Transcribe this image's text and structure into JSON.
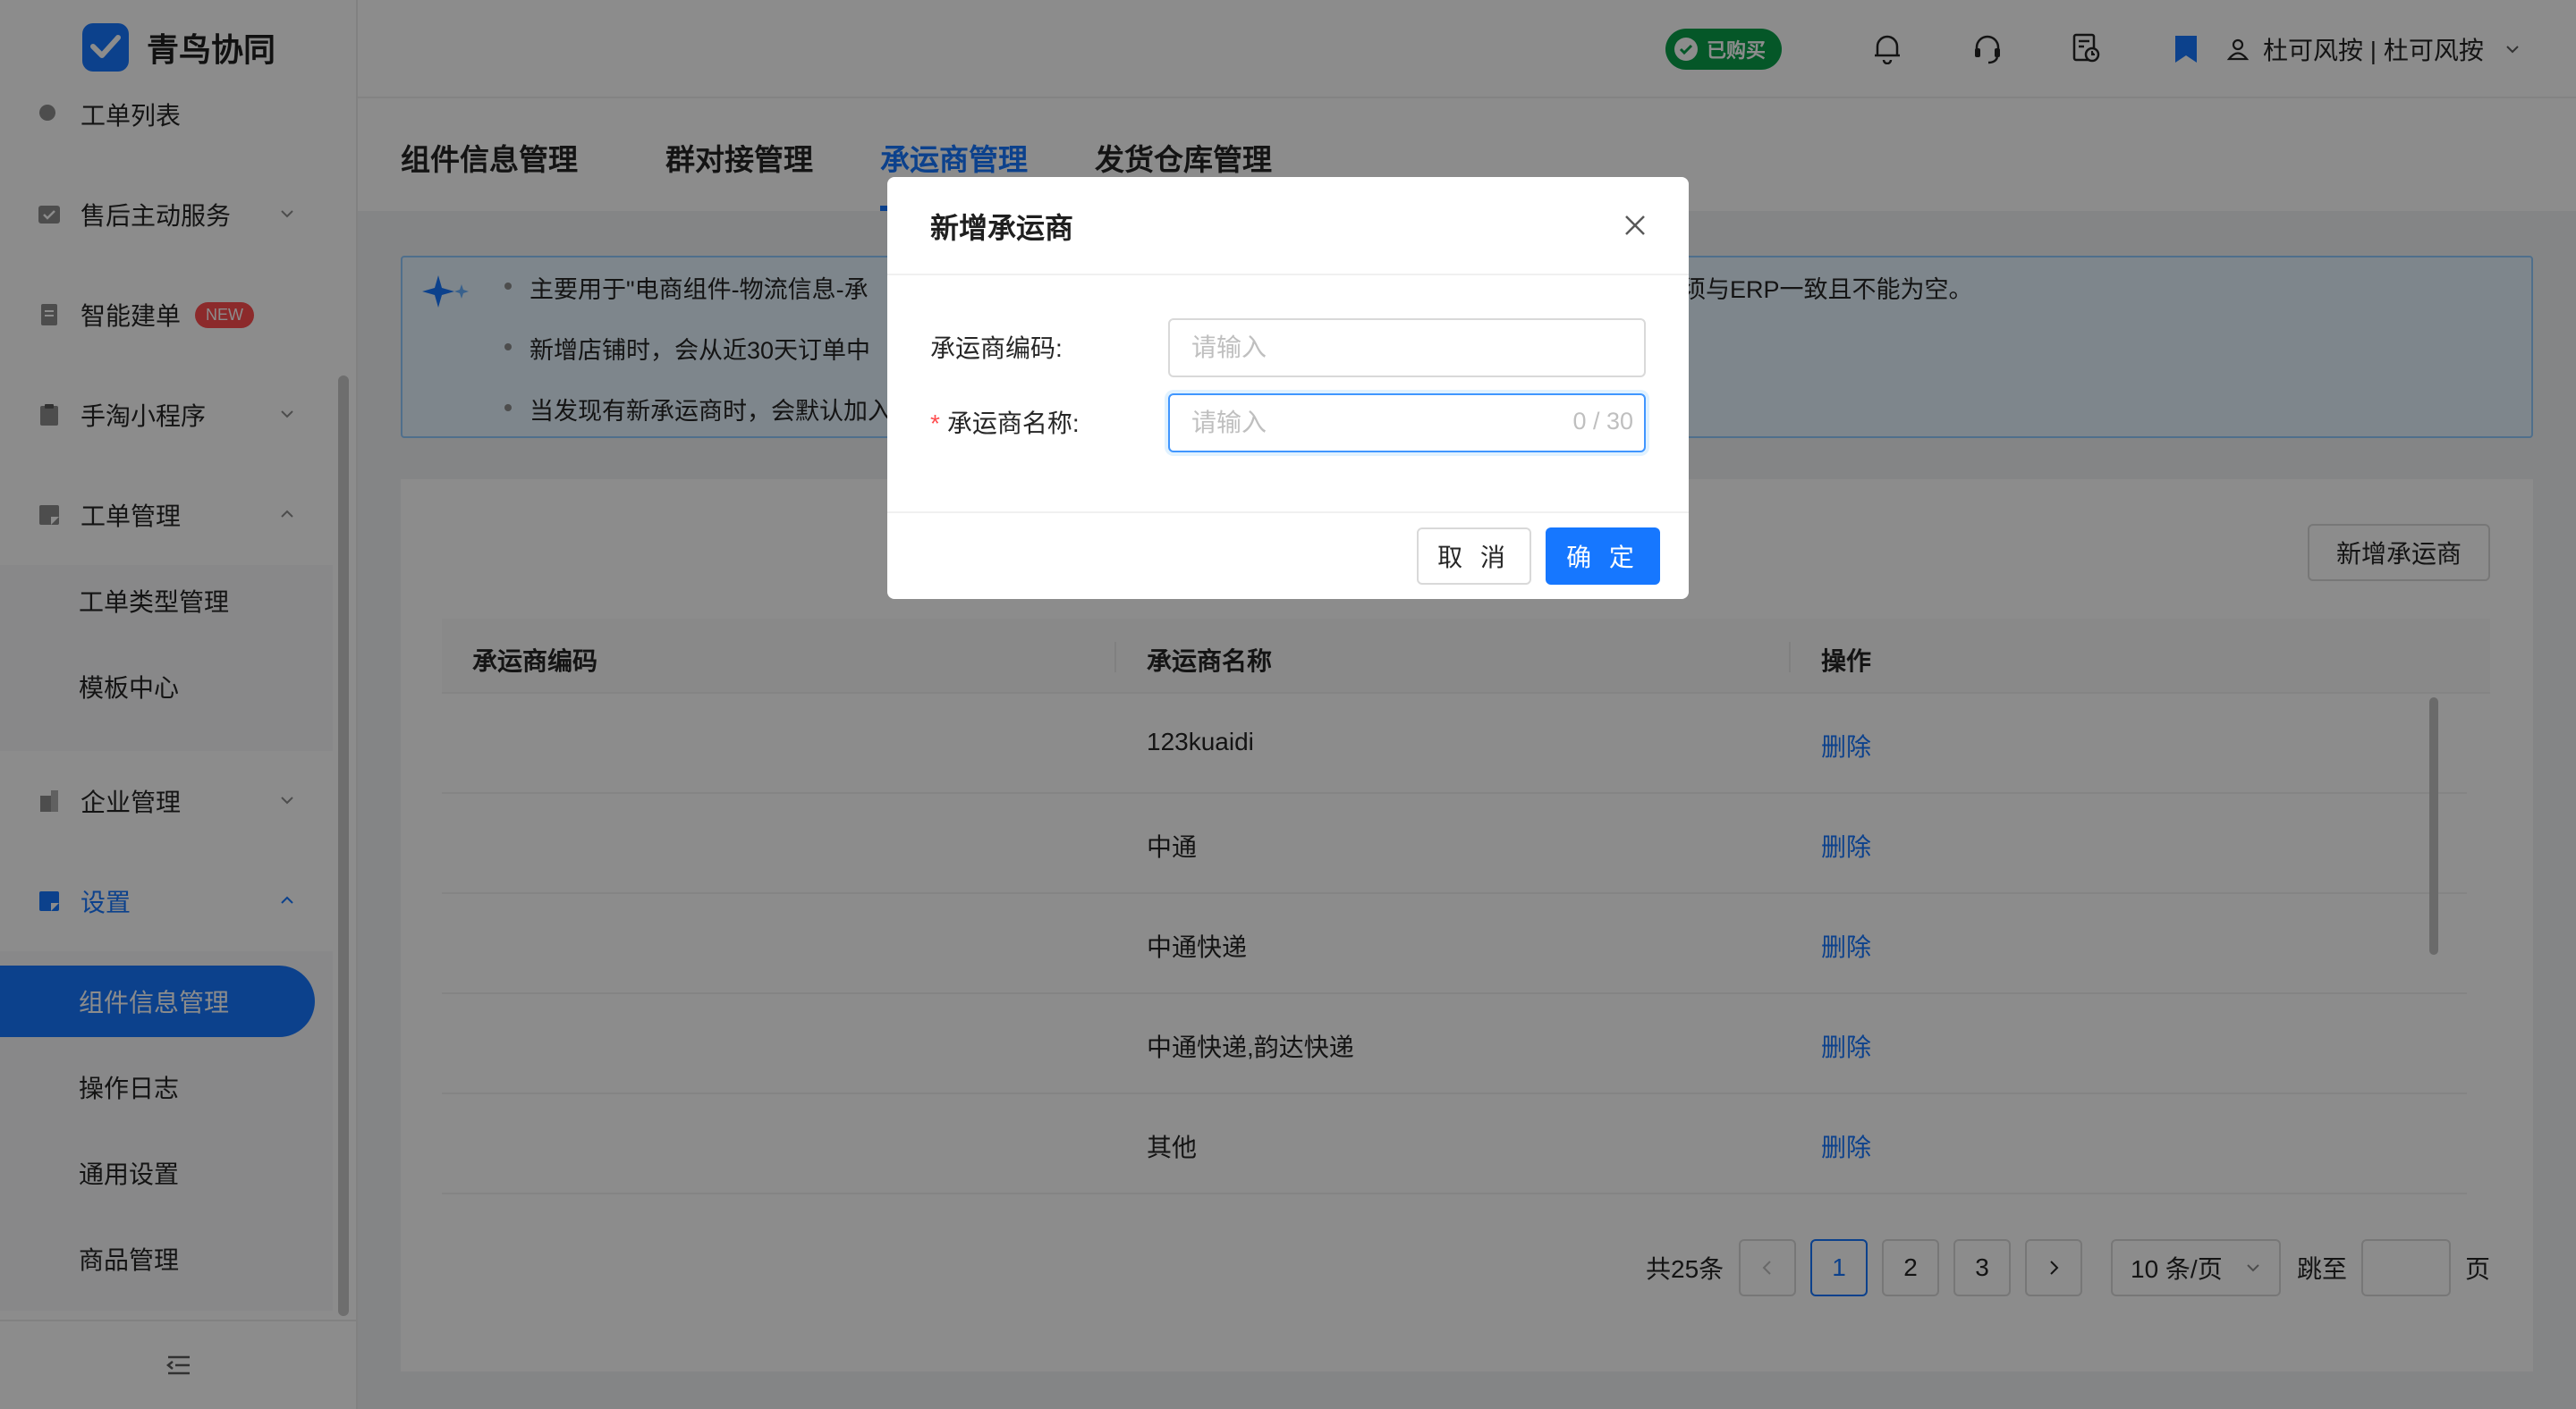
{
  "app": {
    "name": "青鸟协同"
  },
  "sidebar": {
    "items": [
      {
        "label": "工单列表"
      },
      {
        "label": "售后主动服务"
      },
      {
        "label": "智能建单",
        "badge": "NEW"
      },
      {
        "label": "手淘小程序"
      },
      {
        "label": "工单管理"
      },
      {
        "label": "工单类型管理"
      },
      {
        "label": "模板中心"
      },
      {
        "label": "企业管理"
      },
      {
        "label": "设置"
      },
      {
        "label": "组件信息管理"
      },
      {
        "label": "操作日志"
      },
      {
        "label": "通用设置"
      },
      {
        "label": "商品管理"
      }
    ]
  },
  "header": {
    "purchased_label": "已购买",
    "user_label": "杜可风按 | 杜可风按",
    "icons": [
      "bell-icon",
      "headset-icon",
      "order-history-icon",
      "bookmark-icon",
      "user-icon"
    ]
  },
  "tabs": [
    {
      "label": "组件信息管理"
    },
    {
      "label": "群对接管理"
    },
    {
      "label": "承运商管理",
      "active": true
    },
    {
      "label": "发货仓库管理"
    }
  ],
  "notice": {
    "lines": [
      "主要用于\"电商组件-物流信息-承",
      "新增店铺时，会从近30天订单中",
      "当发现有新承运商时，会默认加入"
    ],
    "line1_tail": "须与ERP一致且不能为空。"
  },
  "toolbar": {
    "add_label": "新增承运商"
  },
  "table": {
    "columns": [
      "承运商编码",
      "承运商名称",
      "操作"
    ],
    "rows": [
      {
        "code": "",
        "name": "123kuaidi",
        "action": "删除"
      },
      {
        "code": "",
        "name": "中通",
        "action": "删除"
      },
      {
        "code": "",
        "name": "中通快递",
        "action": "删除"
      },
      {
        "code": "",
        "name": "中通快递,韵达快递",
        "action": "删除"
      },
      {
        "code": "",
        "name": "其他",
        "action": "删除"
      }
    ]
  },
  "pagination": {
    "total_label": "共25条",
    "pages": [
      "1",
      "2",
      "3"
    ],
    "current": "1",
    "page_size_label": "10 条/页",
    "jump_label": "跳至",
    "page_unit": "页"
  },
  "modal": {
    "title": "新增承运商",
    "fields": [
      {
        "label": "承运商编码:",
        "placeholder": "请输入",
        "required": false
      },
      {
        "label": "承运商名称:",
        "placeholder": "请输入",
        "required": true,
        "counter": "0 / 30"
      }
    ],
    "cancel_label": "取 消",
    "ok_label": "确 定"
  },
  "colors": {
    "primary": "#1677ff",
    "purchased": "#0a9e4a",
    "danger": "#ff4d4f"
  }
}
